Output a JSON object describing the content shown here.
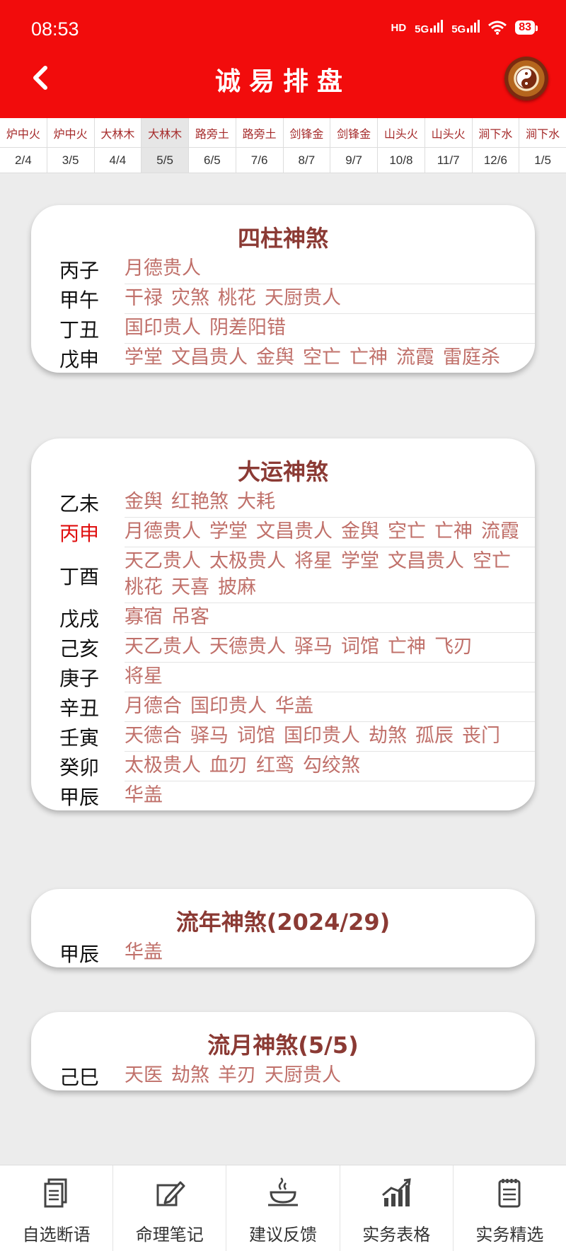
{
  "status": {
    "time": "08:53",
    "hd": "HD",
    "net1": "5G",
    "net2": "5G",
    "battery": "83"
  },
  "header": {
    "title": "诚易排盘"
  },
  "strip": [
    {
      "name": "炉中火",
      "date": "2/4"
    },
    {
      "name": "炉中火",
      "date": "3/5"
    },
    {
      "name": "大林木",
      "date": "4/4"
    },
    {
      "name": "大林木",
      "date": "5/5",
      "active": true
    },
    {
      "name": "路旁土",
      "date": "6/5"
    },
    {
      "name": "路旁土",
      "date": "7/6"
    },
    {
      "name": "剑锋金",
      "date": "8/7"
    },
    {
      "name": "剑锋金",
      "date": "9/7"
    },
    {
      "name": "山头火",
      "date": "10/8"
    },
    {
      "name": "山头火",
      "date": "11/7"
    },
    {
      "name": "涧下水",
      "date": "12/6"
    },
    {
      "name": "涧下水",
      "date": "1/5"
    }
  ],
  "cards": {
    "sizhu": {
      "title": "四柱神煞",
      "rows": [
        {
          "pillar": "丙子",
          "stars": [
            "月德贵人"
          ]
        },
        {
          "pillar": "甲午",
          "stars": [
            "干禄",
            "灾煞",
            "桃花",
            "天厨贵人"
          ]
        },
        {
          "pillar": "丁丑",
          "stars": [
            "国印贵人",
            "阴差阳错"
          ]
        },
        {
          "pillar": "戊申",
          "stars": [
            "学堂",
            "文昌贵人",
            "金舆",
            "空亡",
            "亡神",
            "流霞",
            "雷庭杀"
          ]
        }
      ]
    },
    "dayun": {
      "title": "大运神煞",
      "rows": [
        {
          "pillar": "乙未",
          "stars": [
            "金舆",
            "红艳煞",
            "大耗"
          ]
        },
        {
          "pillar": "丙申",
          "highlight": true,
          "stars": [
            "月德贵人",
            "学堂",
            "文昌贵人",
            "金舆",
            "空亡",
            "亡神",
            "流霞"
          ]
        },
        {
          "pillar": "丁酉",
          "stars": [
            "天乙贵人",
            "太极贵人",
            "将星",
            "学堂",
            "文昌贵人",
            "空亡",
            "桃花",
            "天喜",
            "披麻"
          ]
        },
        {
          "pillar": "戊戌",
          "stars": [
            "寡宿",
            "吊客"
          ]
        },
        {
          "pillar": "己亥",
          "stars": [
            "天乙贵人",
            "天德贵人",
            "驿马",
            "词馆",
            "亡神",
            "飞刃"
          ]
        },
        {
          "pillar": "庚子",
          "stars": [
            "将星"
          ]
        },
        {
          "pillar": "辛丑",
          "stars": [
            "月德合",
            "国印贵人",
            "华盖"
          ]
        },
        {
          "pillar": "壬寅",
          "stars": [
            "天德合",
            "驿马",
            "词馆",
            "国印贵人",
            "劫煞",
            "孤辰",
            "丧门"
          ]
        },
        {
          "pillar": "癸卯",
          "stars": [
            "太极贵人",
            "血刃",
            "红鸾",
            "勾绞煞"
          ]
        },
        {
          "pillar": "甲辰",
          "stars": [
            "华盖"
          ]
        }
      ]
    },
    "liunian": {
      "title": "流年神煞(2024/29)",
      "rows": [
        {
          "pillar": "甲辰",
          "stars": [
            "华盖"
          ]
        }
      ]
    },
    "liuyue": {
      "title": "流月神煞(5/5)",
      "rows": [
        {
          "pillar": "己巳",
          "stars": [
            "天医",
            "劫煞",
            "羊刃",
            "天厨贵人"
          ]
        }
      ]
    }
  },
  "nav": [
    {
      "label": "自选断语",
      "icon": "document-icon"
    },
    {
      "label": "命理笔记",
      "icon": "edit-note-icon"
    },
    {
      "label": "建议反馈",
      "icon": "feedback-icon"
    },
    {
      "label": "实务表格",
      "icon": "chart-icon"
    },
    {
      "label": "实务精选",
      "icon": "notepad-icon"
    }
  ],
  "colors": {
    "header": "#f20c0c",
    "title_text": "#8b3a34",
    "star_text": "#c0706a",
    "highlight": "#e01010"
  }
}
